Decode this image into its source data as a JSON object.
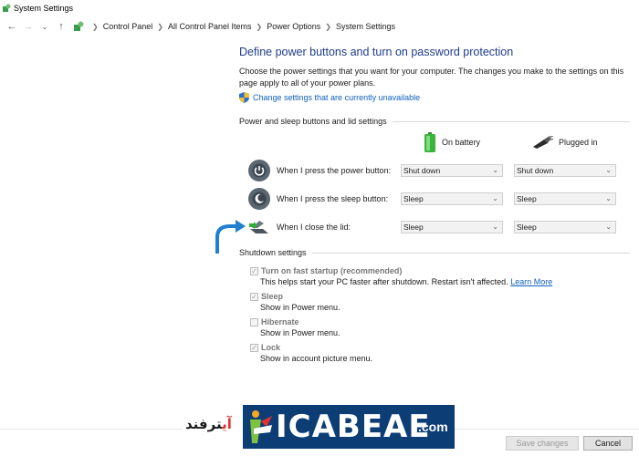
{
  "window": {
    "title": "System Settings"
  },
  "address": {
    "breadcrumbs": [
      "Control Panel",
      "All Control Panel Items",
      "Power Options",
      "System Settings"
    ]
  },
  "main": {
    "title": "Define power buttons and turn on password protection",
    "description": "Choose the power settings that you want for your computer. The changes you make to the settings on this page apply to all of your power plans.",
    "change_link": "Change settings that are currently unavailable"
  },
  "power_group": {
    "header": "Power and sleep buttons and lid settings",
    "col_battery": "On battery",
    "col_plugged": "Plugged in",
    "rows": [
      {
        "label": "When I press the power button:",
        "battery": "Shut down",
        "plugged": "Shut down"
      },
      {
        "label": "When I press the sleep button:",
        "battery": "Sleep",
        "plugged": "Sleep"
      },
      {
        "label": "When I close the lid:",
        "battery": "Sleep",
        "plugged": "Sleep"
      }
    ]
  },
  "shutdown_group": {
    "header": "Shutdown settings",
    "items": [
      {
        "title": "Turn on fast startup (recommended)",
        "desc": "This helps start your PC faster after shutdown. Restart isn't affected.",
        "link": "Learn More",
        "checked": true
      },
      {
        "title": "Sleep",
        "desc": "Show in Power menu.",
        "checked": true
      },
      {
        "title": "Hibernate",
        "desc": "Show in Power menu.",
        "checked": false
      },
      {
        "title": "Lock",
        "desc": "Show in account picture menu.",
        "checked": true
      }
    ]
  },
  "buttons": {
    "save": "Save changes",
    "cancel": "Cancel"
  },
  "watermark": {
    "farsi_red": "آی",
    "farsi_black": "ترفند",
    "letters": "ICABEAE",
    "domain": ".com"
  },
  "colors": {
    "title_blue": "#1e3c8c",
    "link_blue": "#1060c0",
    "watermark_blue": "#0d3d75",
    "arrow_blue": "#1f7fd0"
  },
  "icons": [
    "back-arrow-icon",
    "forward-arrow-icon",
    "recent-dropdown-icon",
    "up-arrow-icon",
    "control-panel-icon",
    "shield-icon",
    "battery-icon",
    "power-plug-icon",
    "power-button-icon",
    "sleep-button-icon",
    "laptop-lid-icon"
  ]
}
